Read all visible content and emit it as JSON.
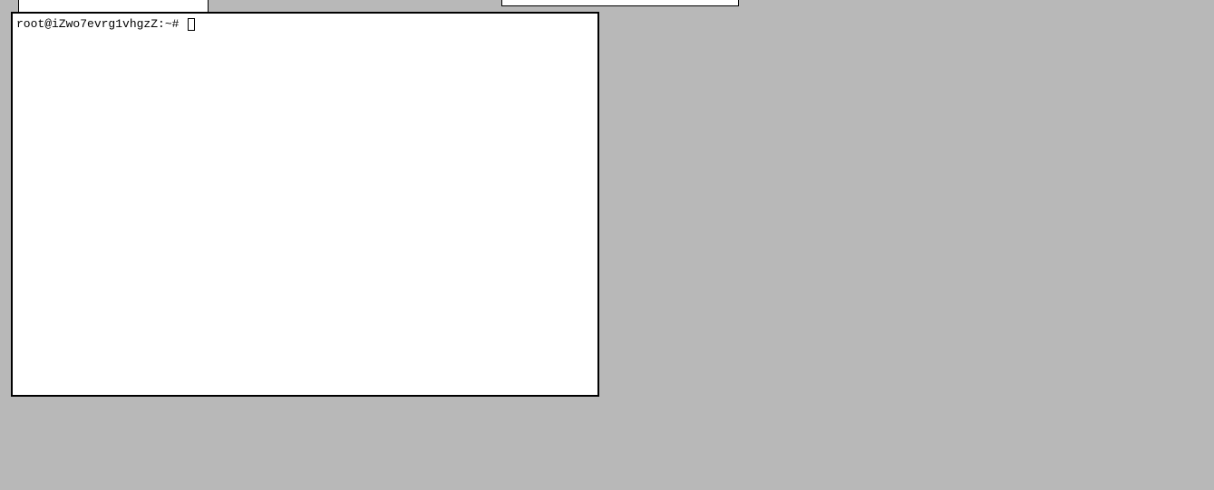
{
  "terminal": {
    "prompt": "root@iZwo7evrg1vhgzZ:~# "
  }
}
